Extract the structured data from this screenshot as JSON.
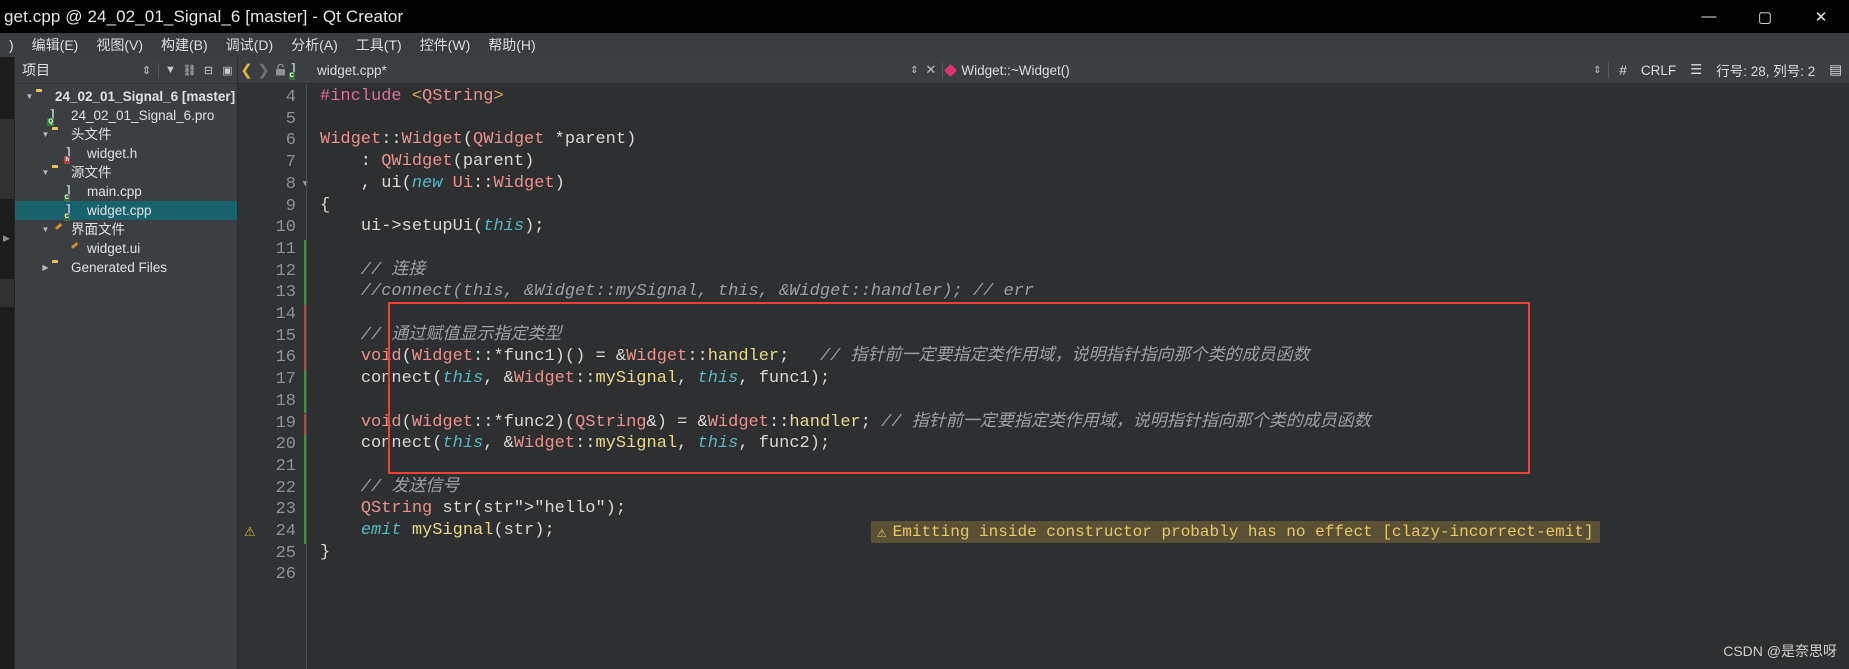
{
  "window": {
    "title": "get.cpp @ 24_02_01_Signal_6 [master] - Qt Creator",
    "minimize_label": "—",
    "maximize_label": "▢",
    "close_label": "✕"
  },
  "menubar": {
    "items": [
      {
        "label": ")"
      },
      {
        "label": "编辑(E)"
      },
      {
        "label": "视图(V)"
      },
      {
        "label": "构建(B)"
      },
      {
        "label": "调试(D)"
      },
      {
        "label": "分析(A)"
      },
      {
        "label": "工具(T)"
      },
      {
        "label": "控件(W)"
      },
      {
        "label": "帮助(H)"
      }
    ]
  },
  "sidebar": {
    "title": "项目",
    "tools": [
      {
        "name": "sort-toggle-icon",
        "glyph": "⇕"
      },
      {
        "name": "filter-icon",
        "glyph": "▼"
      },
      {
        "name": "link-icon",
        "glyph": "⛓"
      },
      {
        "name": "expand-all-icon",
        "glyph": "⊟"
      },
      {
        "name": "close-panel-icon",
        "glyph": "▣"
      }
    ],
    "tree": [
      {
        "label": "24_02_01_Signal_6 [master]",
        "indent": 0,
        "twisty": "▼",
        "icon": "qt-project-icon",
        "bold": true,
        "selected": false
      },
      {
        "label": "24_02_01_Signal_6.pro",
        "indent": 1,
        "twisty": "",
        "icon": "qt-pro-file-icon",
        "bold": false,
        "selected": false
      },
      {
        "label": "头文件",
        "indent": 1,
        "twisty": "▼",
        "icon": "folder-headers-icon",
        "bold": false,
        "selected": false
      },
      {
        "label": "widget.h",
        "indent": 2,
        "twisty": "",
        "icon": "header-file-icon",
        "bold": false,
        "selected": false
      },
      {
        "label": "源文件",
        "indent": 1,
        "twisty": "▼",
        "icon": "folder-sources-icon",
        "bold": false,
        "selected": false
      },
      {
        "label": "main.cpp",
        "indent": 2,
        "twisty": "",
        "icon": "cpp-file-icon",
        "bold": false,
        "selected": false
      },
      {
        "label": "widget.cpp",
        "indent": 2,
        "twisty": "",
        "icon": "cpp-file-icon",
        "bold": false,
        "selected": true
      },
      {
        "label": "界面文件",
        "indent": 1,
        "twisty": "▼",
        "icon": "folder-forms-icon",
        "bold": false,
        "selected": false
      },
      {
        "label": "widget.ui",
        "indent": 2,
        "twisty": "",
        "icon": "ui-file-icon",
        "bold": false,
        "selected": false
      },
      {
        "label": "Generated Files",
        "indent": 1,
        "twisty": "▶",
        "icon": "folder-generated-icon",
        "bold": false,
        "selected": false
      }
    ]
  },
  "editor_toolbar": {
    "back_glyph": "❮",
    "forward_glyph": "❯",
    "lock_glyph": "🔓",
    "tab_name": "widget.cpp*",
    "tab_dropdown_glyph": "⇕",
    "tab_close_glyph": "✕",
    "symbol": "Widget::~Widget()",
    "symbol_dropdown_glyph": "⇕",
    "hash_glyph": "#",
    "line_ending": "CRLF",
    "indent_glyph": "☰",
    "cursor_position": "行号: 28, 列号: 2",
    "extra_glyph": "▤"
  },
  "code": {
    "first_line": 4,
    "lines": [
      {
        "n": 4,
        "warn": false,
        "fold": false,
        "change": "none"
      },
      {
        "n": 5,
        "warn": false,
        "fold": false,
        "change": "none"
      },
      {
        "n": 6,
        "warn": false,
        "fold": false,
        "change": "none"
      },
      {
        "n": 7,
        "warn": false,
        "fold": false,
        "change": "none"
      },
      {
        "n": 8,
        "warn": false,
        "fold": true,
        "change": "none"
      },
      {
        "n": 9,
        "warn": false,
        "fold": false,
        "change": "none"
      },
      {
        "n": 10,
        "warn": false,
        "fold": false,
        "change": "none"
      },
      {
        "n": 11,
        "warn": false,
        "fold": false,
        "change": "green"
      },
      {
        "n": 12,
        "warn": false,
        "fold": false,
        "change": "green"
      },
      {
        "n": 13,
        "warn": false,
        "fold": false,
        "change": "green"
      },
      {
        "n": 14,
        "warn": false,
        "fold": false,
        "change": "red"
      },
      {
        "n": 15,
        "warn": false,
        "fold": false,
        "change": "red"
      },
      {
        "n": 16,
        "warn": false,
        "fold": false,
        "change": "red"
      },
      {
        "n": 17,
        "warn": false,
        "fold": false,
        "change": "green"
      },
      {
        "n": 18,
        "warn": false,
        "fold": false,
        "change": "green"
      },
      {
        "n": 19,
        "warn": false,
        "fold": false,
        "change": "red"
      },
      {
        "n": 20,
        "warn": false,
        "fold": false,
        "change": "green"
      },
      {
        "n": 21,
        "warn": false,
        "fold": false,
        "change": "green"
      },
      {
        "n": 22,
        "warn": false,
        "fold": false,
        "change": "green"
      },
      {
        "n": 23,
        "warn": false,
        "fold": false,
        "change": "green"
      },
      {
        "n": 24,
        "warn": true,
        "fold": false,
        "change": "green"
      },
      {
        "n": 25,
        "warn": false,
        "fold": false,
        "change": "none"
      },
      {
        "n": 26,
        "warn": false,
        "fold": false,
        "change": "none"
      }
    ],
    "text": [
      "#include <QString>",
      "",
      "Widget::Widget(QWidget *parent)",
      "    : QWidget(parent)",
      "    , ui(new Ui::Widget)",
      "{",
      "    ui->setupUi(this);",
      "",
      "    // 连接",
      "    //connect(this, &Widget::mySignal, this, &Widget::handler); // err",
      "",
      "    // 通过赋值显示指定类型",
      "    void(Widget::*func1)() = &Widget::handler;   // 指针前一定要指定类作用域，说明指针指向那个类的成员函数",
      "    connect(this, &Widget::mySignal, this, func1);",
      "",
      "    void(Widget::*func2)(QString&) = &Widget::handler; // 指针前一定要指定类作用域，说明指针指向那个类的成员函数",
      "    connect(this, &Widget::mySignal, this, func2);",
      "",
      "    // 发送信号",
      "    QString str(\"hello\");",
      "    emit mySignal(str);",
      "}",
      ""
    ]
  },
  "annotations": {
    "red_box_label": "highlighted-code-region",
    "warning": {
      "icon_glyph": "⚠",
      "text": "Emitting inside constructor probably has no effect [clazy-incorrect-emit]"
    },
    "watermark": "CSDN @是奈思呀"
  },
  "colors": {
    "accent_selection": "#17626b",
    "warning_text": "#e3c96a",
    "warning_bg": "#5a5033",
    "annotation_red": "#f0403a",
    "titlebar_bg": "#000000",
    "chrome_bg": "#3c3f41",
    "editor_bg": "#2e2f30",
    "gutter_bg": "#313234"
  }
}
